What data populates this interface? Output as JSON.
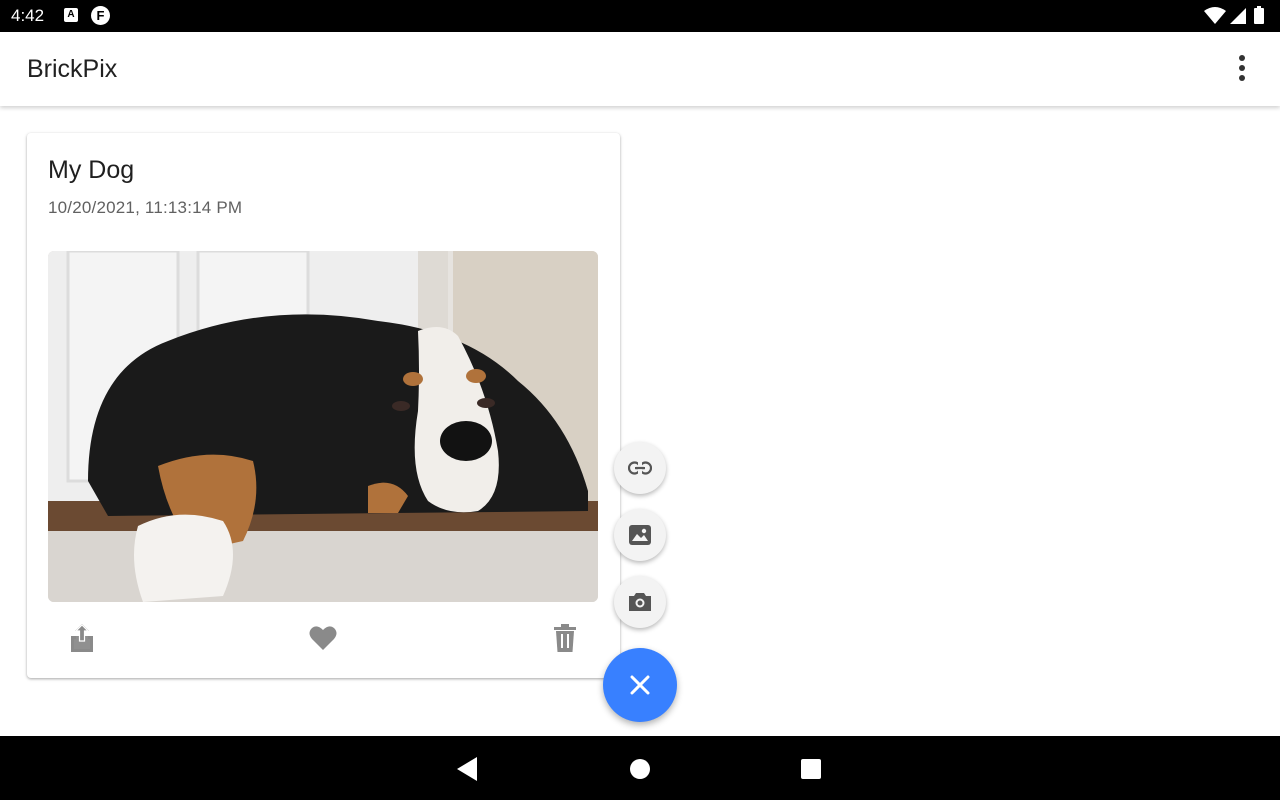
{
  "status_bar": {
    "time": "4:42",
    "badge_a": "A",
    "badge_f": "F"
  },
  "app_bar": {
    "title": "BrickPix",
    "overflow_icon": "more-vert-icon"
  },
  "card": {
    "title": "My Dog",
    "timestamp": "10/20/2021, 11:13:14 PM",
    "actions": [
      "share-icon",
      "heart-icon",
      "trash-icon"
    ]
  },
  "fab": {
    "mini_actions": [
      "link-icon",
      "image-icon",
      "camera-icon"
    ],
    "main_icon": "close-icon",
    "main_color": "#3880ff",
    "mini_color": "#f3f3f3"
  },
  "nav_bar": {
    "buttons": [
      "back-icon",
      "home-icon",
      "recents-icon"
    ]
  }
}
